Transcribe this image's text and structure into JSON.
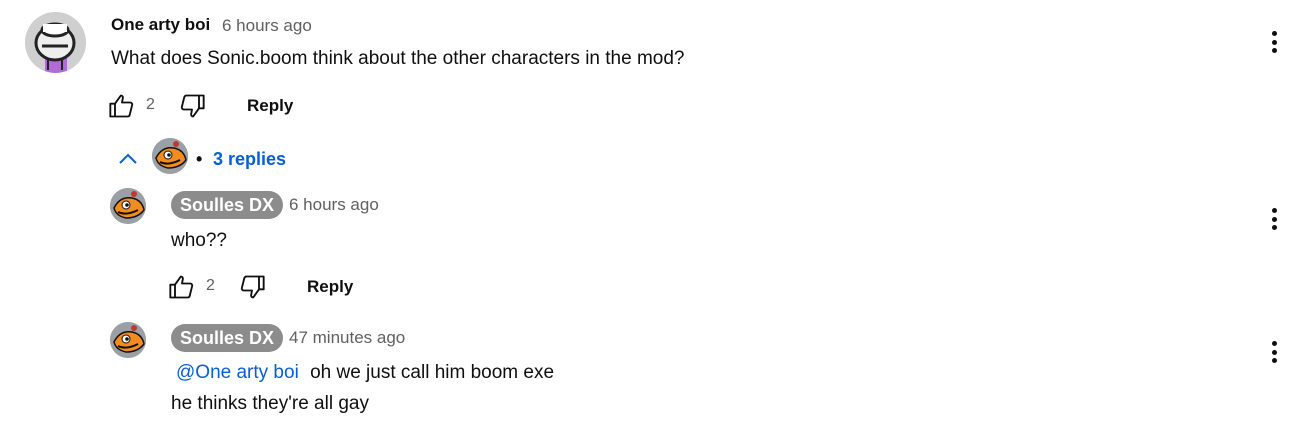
{
  "comment": {
    "author": "One arty boi",
    "time": "6 hours ago",
    "text": "What does Sonic.boom think about the other characters in the mod?",
    "likes": "2",
    "reply_label": "Reply",
    "menu_icon": "more-vert-icon"
  },
  "replies_toggle": {
    "label": "3 replies",
    "separator": "•",
    "icon": "chevron-up-icon"
  },
  "replies": [
    {
      "author": "Soulles DX",
      "time": "6 hours ago",
      "text": "who??",
      "likes": "2",
      "reply_label": "Reply"
    },
    {
      "author": "Soulles DX",
      "time": "47 minutes ago",
      "mention": "@One arty boi",
      "text_line1": "oh we just call him boom exe",
      "text_line2": "he thinks they're all gay"
    }
  ],
  "colors": {
    "link": "#065fd4",
    "chip": "#8c8c8c",
    "text": "#0f0f0f",
    "meta": "#606060"
  }
}
